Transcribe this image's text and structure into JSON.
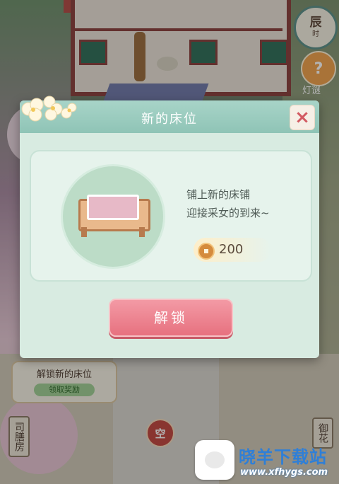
{
  "hud": {
    "time_main": "辰",
    "time_sub": "时",
    "riddle_icon": "?",
    "riddle_label": "灯谜"
  },
  "background": {
    "mission_title": "解锁新的床位",
    "mission_reward": "领取奖励",
    "sign_left": "司膳房",
    "sign_right": "御花",
    "empty_badge": "空"
  },
  "modal": {
    "title": "新的床位",
    "description_line1": "铺上新的床铺",
    "description_line2": "迎接采女的到来~",
    "cost": "200",
    "cost_icon": "coin-icon",
    "unlock_label": "解锁",
    "close_icon": "close-icon"
  },
  "watermark": {
    "title": "晓羊下载站",
    "url": "www.xfhygs.com"
  },
  "colors": {
    "modal_bg": "#d8ebe1",
    "header": "#8fc4b6",
    "unlock": "#e7717f",
    "close": "#d25a62"
  }
}
